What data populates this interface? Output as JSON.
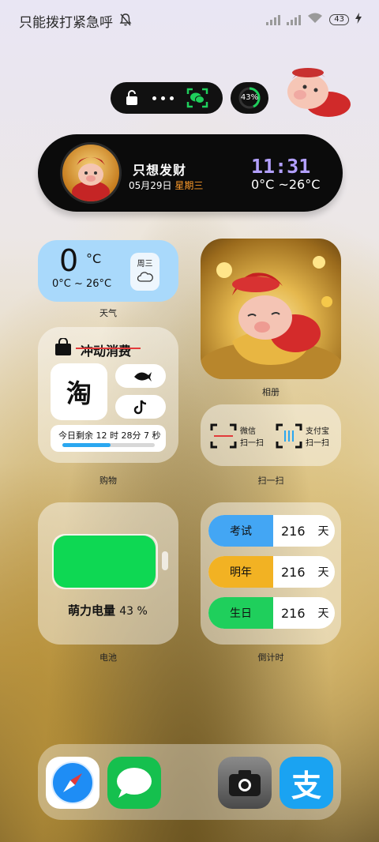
{
  "status_bar": {
    "carrier": "只能拨打紧急呼",
    "battery": "43"
  },
  "capsule": {
    "battery_percent": "43%"
  },
  "time_card": {
    "name": "只想发财",
    "date": "05月29日",
    "weekday": "星期三",
    "time": "11:31",
    "temp_range": "0°C ~26°C"
  },
  "weather": {
    "temp": "0",
    "unit": "°C",
    "range": "0°C ~ 26°C",
    "day": "周三",
    "caption": "天气"
  },
  "album": {
    "caption": "相册"
  },
  "shopping": {
    "title": "冲动消费",
    "taobao_char": "淘",
    "countdown_text": "今日剩余  12 时 28分  7 秒",
    "progress": 0.52,
    "caption": "购物"
  },
  "scan": {
    "wechat_label": "微信",
    "wechat_sub": "扫一扫",
    "alipay_label": "支付宝",
    "alipay_sub": "扫一扫",
    "caption": "扫一扫"
  },
  "battery_widget": {
    "label": "萌力电量",
    "percent": "43 %",
    "level": 0.43,
    "caption": "电池"
  },
  "countdown": {
    "items": [
      {
        "label": "考试",
        "days": "216",
        "unit": "天",
        "color": "#43a6f4"
      },
      {
        "label": "明年",
        "days": "216",
        "unit": "天",
        "color": "#f2b223"
      },
      {
        "label": "生日",
        "days": "216",
        "unit": "天",
        "color": "#1fcf5c"
      }
    ],
    "caption": "倒计时"
  },
  "dock": {
    "apps": [
      "safari-browser-icon",
      "messages-icon",
      "camera-icon",
      "alipay-icon"
    ],
    "alipay_char": "支"
  },
  "colors": {
    "weather_bg": "#a9d9fb",
    "clock": "#b3a0ff",
    "weekday": "#ff9c2a",
    "battery_green": "#0ed853"
  }
}
